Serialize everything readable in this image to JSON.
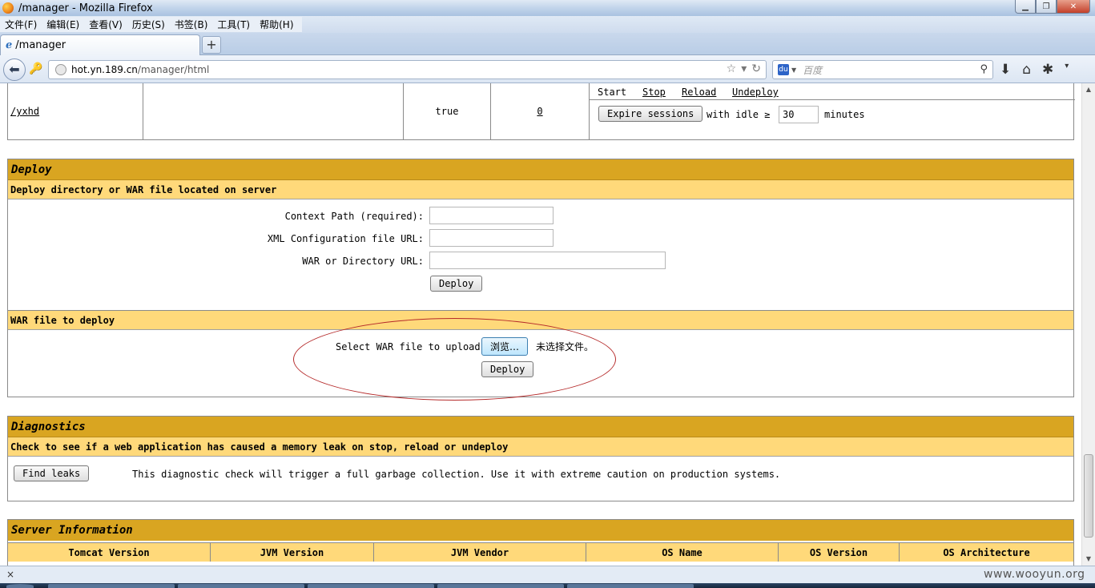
{
  "window": {
    "title": "/manager - Mozilla Firefox"
  },
  "menu": [
    "文件(F)",
    "编辑(E)",
    "查看(V)",
    "历史(S)",
    "书签(B)",
    "工具(T)",
    "帮助(H)"
  ],
  "tab": {
    "label": "/manager",
    "new_tab": "+"
  },
  "nav": {
    "url_host": "hot.yn.189.cn",
    "url_path": "/manager/html",
    "search_placeholder": "百度"
  },
  "app_row": {
    "path": "/yxhd",
    "running": "true",
    "sessions": "0",
    "commands": [
      "Start",
      "Stop",
      "Reload",
      "Undeploy"
    ],
    "expire_button": "Expire sessions",
    "with_idle": "with idle ≥",
    "idle_value": "30",
    "minutes": "minutes"
  },
  "deploy": {
    "title": "Deploy",
    "server_heading": "Deploy directory or WAR file located on server",
    "context_path_label": "Context Path (required):",
    "xml_url_label": "XML Configuration file URL:",
    "war_dir_label": "WAR or Directory URL:",
    "deploy_button": "Deploy",
    "war_heading": "WAR file to deploy",
    "select_label": "Select WAR file to upload",
    "browse_button": "浏览…",
    "no_file": "未选择文件。",
    "upload_deploy_button": "Deploy"
  },
  "diagnostics": {
    "title": "Diagnostics",
    "heading": "Check to see if a web application has caused a memory leak on stop, reload or undeploy",
    "find_leaks_button": "Find leaks",
    "note": "This diagnostic check will trigger a full garbage collection. Use it with extreme caution on production systems."
  },
  "server_info": {
    "title": "Server Information",
    "columns": [
      "Tomcat Version",
      "JVM Version",
      "JVM Vendor",
      "OS Name",
      "OS Version",
      "OS Architecture"
    ]
  },
  "status": {
    "close": "×"
  },
  "watermark": "www.wooyun.org",
  "colors": {
    "band_dark": "#d9a521",
    "band_light": "#ffd97a",
    "annotation": "#b52a2a"
  }
}
